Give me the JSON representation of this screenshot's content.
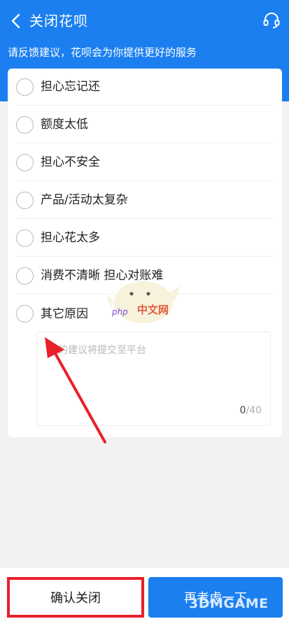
{
  "header": {
    "title": "关闭花呗",
    "subtitle": "请反馈建议，花呗会为你提供更好的服务",
    "back_icon": "chevron-left-icon",
    "support_icon": "headset-icon"
  },
  "options": [
    {
      "label": "担心忘记还",
      "checked": false
    },
    {
      "label": "额度太低",
      "checked": false
    },
    {
      "label": "担心不安全",
      "checked": false
    },
    {
      "label": "产品/活动太复杂",
      "checked": false
    },
    {
      "label": "担心花太多",
      "checked": false
    },
    {
      "label": "消费不清晰 担心对账难",
      "checked": false
    },
    {
      "label": "其它原因",
      "checked": false
    }
  ],
  "feedback": {
    "placeholder": "的建议将提交至平台",
    "count": "0",
    "max": "/40"
  },
  "buttons": {
    "confirm": "确认关闭",
    "reconsider": "再考虑一下"
  },
  "watermarks": {
    "site": "中文网",
    "site_prefix": "php",
    "game": "3DMGAME"
  },
  "colors": {
    "brand": "#1b7ff0",
    "highlight": "#e8202a"
  }
}
